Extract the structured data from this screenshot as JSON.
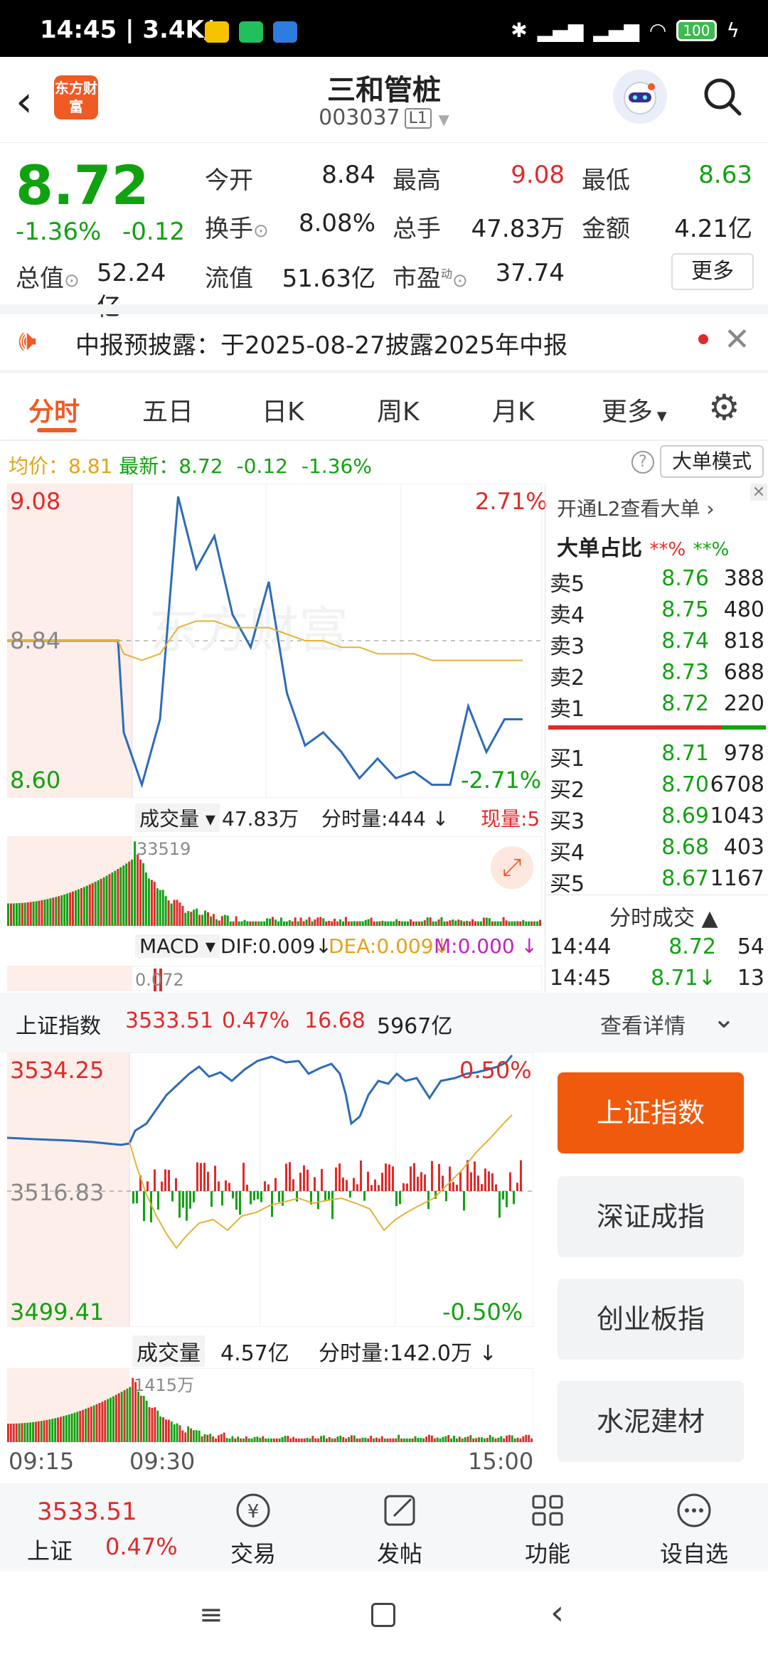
{
  "status_bar": {
    "time": "14:45",
    "speed": "3.4K/s",
    "battery": "100"
  },
  "header": {
    "back_icon": "chevron-left-icon",
    "logo_text": "东方财富",
    "title": "三和管桩",
    "code": "003037",
    "level": "L1",
    "search_icon": "search-icon"
  },
  "quote": {
    "price": "8.72",
    "change_pct": "-1.36%",
    "change": "-0.12",
    "open_label": "今开",
    "open": "8.84",
    "high_label": "最高",
    "high": "9.08",
    "low_label": "最低",
    "low": "8.63",
    "turnover_label": "换手",
    "turnover": "8.08%",
    "volume_label": "总手",
    "volume": "47.83万",
    "amount_label": "金额",
    "amount": "4.21亿",
    "mktcap_label": "总值",
    "mktcap": "52.24亿",
    "float_label": "流值",
    "float": "51.63亿",
    "pe_label": "市盈",
    "pe_sup": "动",
    "pe": "37.74",
    "more_label": "更多"
  },
  "notice": {
    "text": "中报预披露：于2025-08-27披露2025年中报"
  },
  "tabs": [
    "分时",
    "五日",
    "日K",
    "周K",
    "月K",
    "更多"
  ],
  "intraday": {
    "avg_label": "均价：8.81",
    "last_label": "最新：8.72",
    "chg": "-0.12",
    "pct": "-1.36%",
    "big_mode": "大单模式",
    "y_high": "9.08",
    "y_mid": "8.84",
    "y_low": "8.60",
    "pct_high": "2.71%",
    "pct_low": "-2.71%",
    "volume_label": "成交量",
    "volume_total": "47.83万",
    "tick_vol": "分时量:444",
    "now_vol": "现量:5",
    "vol_max": "33519",
    "macd_label": "MACD",
    "dif": "DIF:0.009",
    "dea": "DEA:0.009",
    "m": "M:0.000",
    "macd_val": "0.072",
    "watermark": "东方财富"
  },
  "order_book": {
    "l2_link": "开通L2查看大单",
    "big_ratio_label": "大单占比",
    "big_ratio_sell": "**%",
    "big_ratio_buy": "**%",
    "asks": [
      {
        "label": "卖5",
        "price": "8.76",
        "vol": "388"
      },
      {
        "label": "卖4",
        "price": "8.75",
        "vol": "480"
      },
      {
        "label": "卖3",
        "price": "8.74",
        "vol": "818"
      },
      {
        "label": "卖2",
        "price": "8.73",
        "vol": "688"
      },
      {
        "label": "卖1",
        "price": "8.72",
        "vol": "220"
      }
    ],
    "bids": [
      {
        "label": "买1",
        "price": "8.71",
        "vol": "978"
      },
      {
        "label": "买2",
        "price": "8.70",
        "vol": "6708"
      },
      {
        "label": "买3",
        "price": "8.69",
        "vol": "1043"
      },
      {
        "label": "买4",
        "price": "8.68",
        "vol": "403"
      },
      {
        "label": "买5",
        "price": "8.67",
        "vol": "1167"
      }
    ],
    "ticks_label": "分时成交",
    "ticks": [
      {
        "time": "14:44",
        "price": "8.72",
        "vol": "54"
      },
      {
        "time": "14:45",
        "price": "8.71↓",
        "vol": "13"
      }
    ]
  },
  "index_bar": {
    "name": "上证指数",
    "value": "3533.51",
    "pct": "0.47%",
    "chg": "16.68",
    "amount": "5967亿",
    "detail": "查看详情"
  },
  "index_chart": {
    "y_high": "3534.25",
    "y_mid": "3516.83",
    "y_low": "3499.41",
    "pct_high": "0.50%",
    "pct_low": "-0.50%",
    "volume_label": "成交量",
    "volume_total": "4.57亿",
    "tick_vol": "分时量:142.0万",
    "vol_max": "1415万",
    "x_start": "09:15",
    "x_open": "09:30",
    "x_end": "15:00"
  },
  "index_buttons": [
    "上证指数",
    "深证成指",
    "创业板指",
    "水泥建材"
  ],
  "bottom_nav": {
    "index_value": "3533.51",
    "index_name": "上证",
    "index_pct": "0.47%",
    "items": [
      "交易",
      "发帖",
      "功能",
      "设自选"
    ]
  },
  "chart_data": {
    "type": "line",
    "title": "",
    "series": [
      {
        "name": "",
        "values": [
          8.84,
          8.84,
          8.84,
          8.84,
          8.7,
          8.62,
          8.72,
          9.06,
          8.95,
          9.0,
          8.88,
          8.83,
          8.93,
          8.76,
          8.68,
          8.7,
          8.67,
          8.63,
          8.66,
          8.63,
          8.64,
          8.62,
          8.62,
          8.74,
          8.67,
          8.72,
          8.72
        ]
      },
      {
        "name": "",
        "values": [
          8.84,
          8.84,
          8.84,
          8.84,
          8.82,
          8.81,
          8.82,
          8.86,
          8.87,
          8.87,
          8.86,
          8.86,
          8.86,
          8.85,
          8.84,
          8.84,
          8.83,
          8.83,
          8.82,
          8.82,
          8.82,
          8.81,
          8.81,
          8.81,
          8.81,
          8.81,
          8.81
        ]
      }
    ],
    "ylim": [
      8.6,
      9.08
    ],
    "xlabel": "",
    "ylabel": ""
  }
}
